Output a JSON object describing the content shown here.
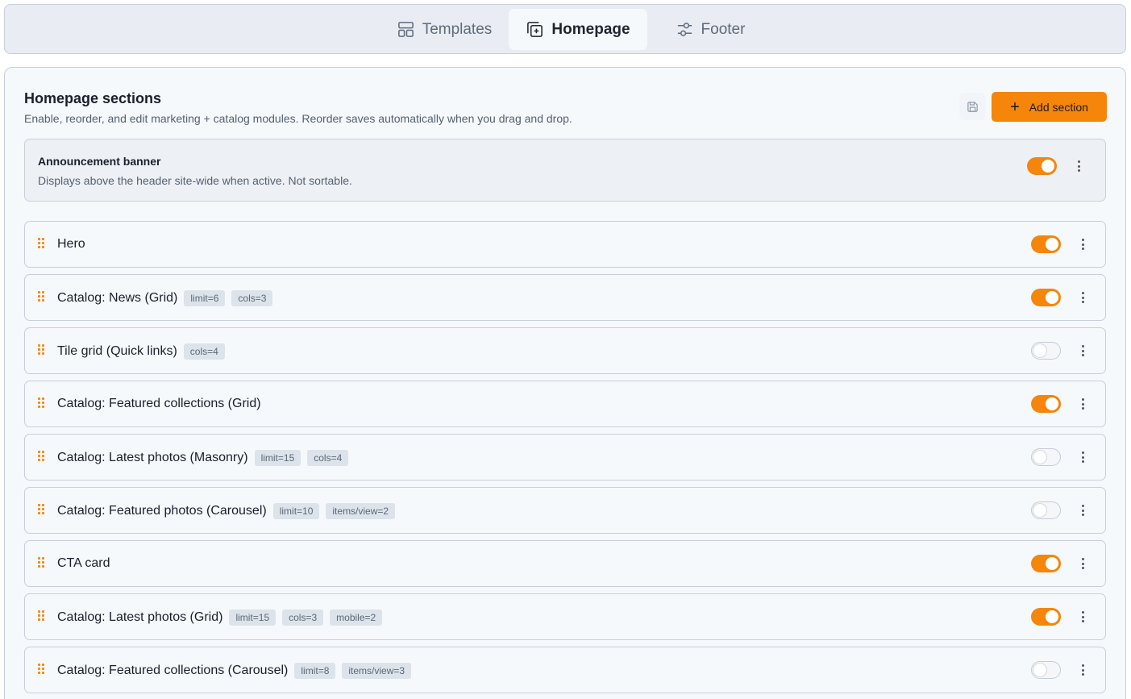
{
  "tabs": [
    {
      "label": "Templates",
      "icon": "layout-icon",
      "active": false
    },
    {
      "label": "Homepage",
      "icon": "add-page-icon",
      "active": true
    },
    {
      "label": "Footer",
      "icon": "sliders-icon",
      "active": false
    }
  ],
  "panel": {
    "title": "Homepage sections",
    "subtitle": "Enable, reorder, and edit marketing + catalog modules. Reorder saves automatically when you drag and drop.",
    "add_label": "Add section",
    "accent": "#f5850b"
  },
  "announcement": {
    "title": "Announcement banner",
    "subtitle": "Displays above the header site-wide when active. Not sortable.",
    "enabled": true
  },
  "sections": [
    {
      "label": "Hero",
      "chips": [],
      "enabled": true
    },
    {
      "label": "Catalog: News (Grid)",
      "chips": [
        "limit=6",
        "cols=3"
      ],
      "enabled": true
    },
    {
      "label": "Tile grid (Quick links)",
      "chips": [
        "cols=4"
      ],
      "enabled": false
    },
    {
      "label": "Catalog: Featured collections (Grid)",
      "chips": [],
      "enabled": true
    },
    {
      "label": "Catalog: Latest photos (Masonry)",
      "chips": [
        "limit=15",
        "cols=4"
      ],
      "enabled": false
    },
    {
      "label": "Catalog: Featured photos (Carousel)",
      "chips": [
        "limit=10",
        "items/view=2"
      ],
      "enabled": false
    },
    {
      "label": "CTA card",
      "chips": [],
      "enabled": true
    },
    {
      "label": "Catalog: Latest photos (Grid)",
      "chips": [
        "limit=15",
        "cols=3",
        "mobile=2"
      ],
      "enabled": true
    },
    {
      "label": "Catalog: Featured collections (Carousel)",
      "chips": [
        "limit=8",
        "items/view=3"
      ],
      "enabled": false
    }
  ]
}
